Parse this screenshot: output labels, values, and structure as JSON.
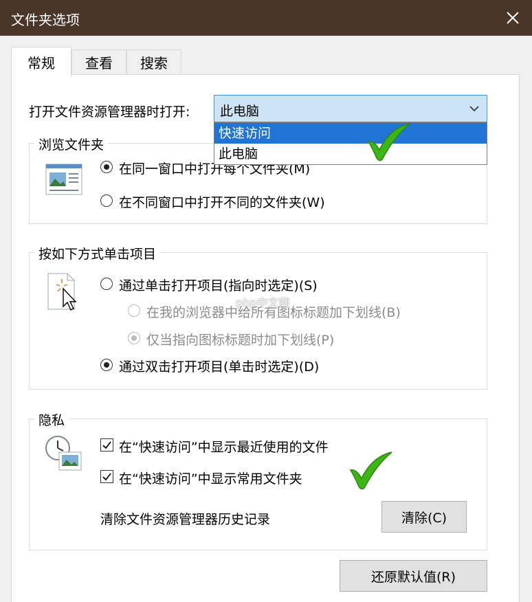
{
  "window": {
    "title": "文件夹选项",
    "close_icon": "close-icon"
  },
  "tabs": [
    {
      "label": "常规",
      "active": true
    },
    {
      "label": "查看",
      "active": false
    },
    {
      "label": "搜索",
      "active": false
    }
  ],
  "open_explorer": {
    "label": "打开文件资源管理器时打开:",
    "selected": "此电脑",
    "options": [
      "快速访问",
      "此电脑"
    ],
    "highlighted": "快速访问"
  },
  "browse_folders": {
    "legend": "浏览文件夹",
    "options": [
      {
        "label": "在同一窗口中打开每个文件夹(M)",
        "checked": true
      },
      {
        "label": "在不同窗口中打开不同的文件夹(W)",
        "checked": false
      }
    ]
  },
  "click_items": {
    "legend": "按如下方式单击项目",
    "single_click": {
      "label": "通过单击打开项目(指向时选定)(S)",
      "checked": false
    },
    "sub_options": [
      {
        "label": "在我的浏览器中给所有图标标题加下划线(B)",
        "checked": false,
        "disabled": true
      },
      {
        "label": "仅当指向图标标题时加下划线(P)",
        "checked": true,
        "disabled": true
      }
    ],
    "double_click": {
      "label": "通过双击打开项目(单击时选定)(D)",
      "checked": true
    }
  },
  "privacy": {
    "legend": "隐私",
    "checkboxes": [
      {
        "label": "在“快速访问”中显示最近使用的文件",
        "checked": true
      },
      {
        "label": "在“快速访问”中显示常用文件夹",
        "checked": true
      }
    ],
    "clear_label": "清除文件资源管理器历史记录",
    "clear_button": "清除(C)"
  },
  "restore_button": "还原默认值(R)",
  "watermark": "php中文网",
  "colors": {
    "titlebar": "#4a3529",
    "highlight": "#1f74d6",
    "tick_green": "#3cb515"
  }
}
